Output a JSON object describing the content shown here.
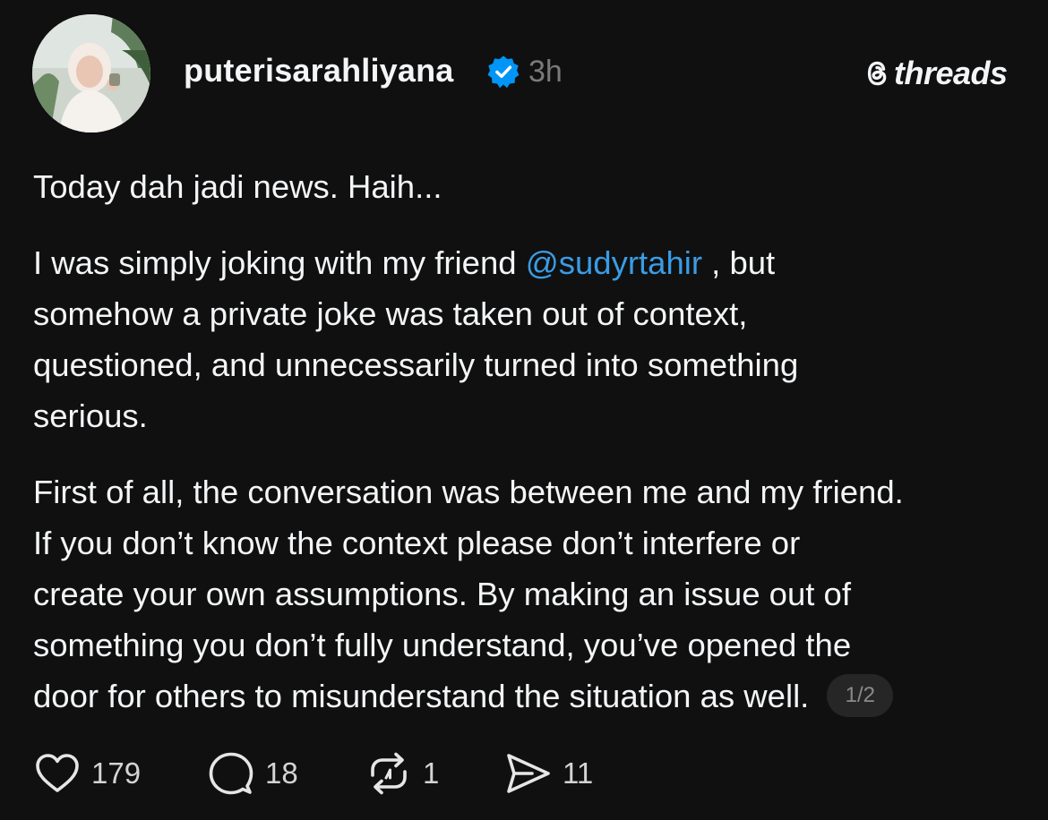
{
  "post": {
    "username": "puterisarahliyana",
    "verified_icon": "verified-badge-icon",
    "timestamp": "3h",
    "brand": "threads",
    "paragraphs": {
      "p1": [
        "Today dah jadi news. Haih..."
      ],
      "p2": {
        "line1_before": "I was simply joking with my friend ",
        "mention": "@sudyrtahir",
        "line1_after": " , but",
        "lines": [
          "somehow a private joke was taken out of context,",
          "questioned, and unnecessarily turned into something",
          "serious."
        ]
      },
      "p3": [
        "First of all, the conversation was between me and my friend.",
        "If you don’t know the context please don’t interfere or",
        "create your own assumptions. By making an issue out of",
        "something you don’t fully understand, you’ve opened the",
        "door for others to misunderstand the situation as well."
      ]
    },
    "page_indicator": "1/2",
    "actions": {
      "likes": "179",
      "replies": "18",
      "reposts": "1",
      "shares": "11"
    },
    "colors": {
      "background": "#101010",
      "text": "#f3f5f7",
      "muted": "#7a7a7a",
      "mention": "#3a9ce6",
      "verified": "#0095f6"
    }
  }
}
